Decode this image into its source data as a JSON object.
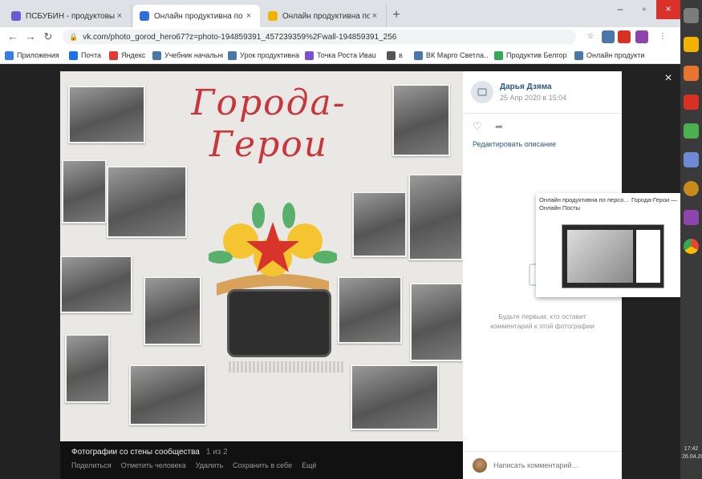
{
  "browser": {
    "tabs": [
      {
        "title": "ПСБУБИН - продуктовый к…",
        "color": "#6a5acd"
      },
      {
        "title": "Онлайн продуктивна по персо…",
        "color": "#2f6fd6"
      },
      {
        "title": "Онлайн продуктивна по персо…",
        "color": "#f2b200"
      }
    ],
    "new_tab": "+",
    "url": "vk.com/photo_gorod_hero67?z=photo-194859391_457239359%2Fwall-194859391_256",
    "bookmarks": [
      {
        "label": "Приложения",
        "color": "#3b7be8"
      },
      {
        "label": "Почта",
        "color": "#1a73e8"
      },
      {
        "label": "Яндекс",
        "color": "#e53935"
      },
      {
        "label": "Учебник начального…",
        "color": "#4a76a8"
      },
      {
        "label": "Урок продуктивна…",
        "color": "#4a76a8"
      },
      {
        "label": "Точка Роста Иваш…",
        "color": "#7b4fd6"
      },
      {
        "label": "в",
        "color": "#555555"
      },
      {
        "label": "ВК Марго Светла…",
        "color": "#4a76a8"
      },
      {
        "label": "Продуктив Белгор…",
        "color": "#34a853"
      },
      {
        "label": "Онлайн продуктив…",
        "color": "#4a76a8"
      }
    ]
  },
  "poster": {
    "title": "Города-Герои"
  },
  "viewer": {
    "album": "Фотографии со стены сообщества",
    "count": "1 из 2",
    "links": [
      "Поделиться",
      "Отметить человека",
      "Удалить",
      "Сохранить в себе",
      "Ещё"
    ],
    "author": "Дарья Дзяма",
    "date": "25 Апр 2020 в 15:04",
    "add_description": "Редактировать описание",
    "empty_text": "Будьте первым, кто оставит комментарий к этой фотографии",
    "comment_placeholder": "Написать комментарий…",
    "close": "×"
  },
  "preview": {
    "title": "Онлайн продуктивна по персо… Города-Герои — Онлайн Посты"
  },
  "taskbar": {
    "clock": "17:42 26.04.2020"
  }
}
